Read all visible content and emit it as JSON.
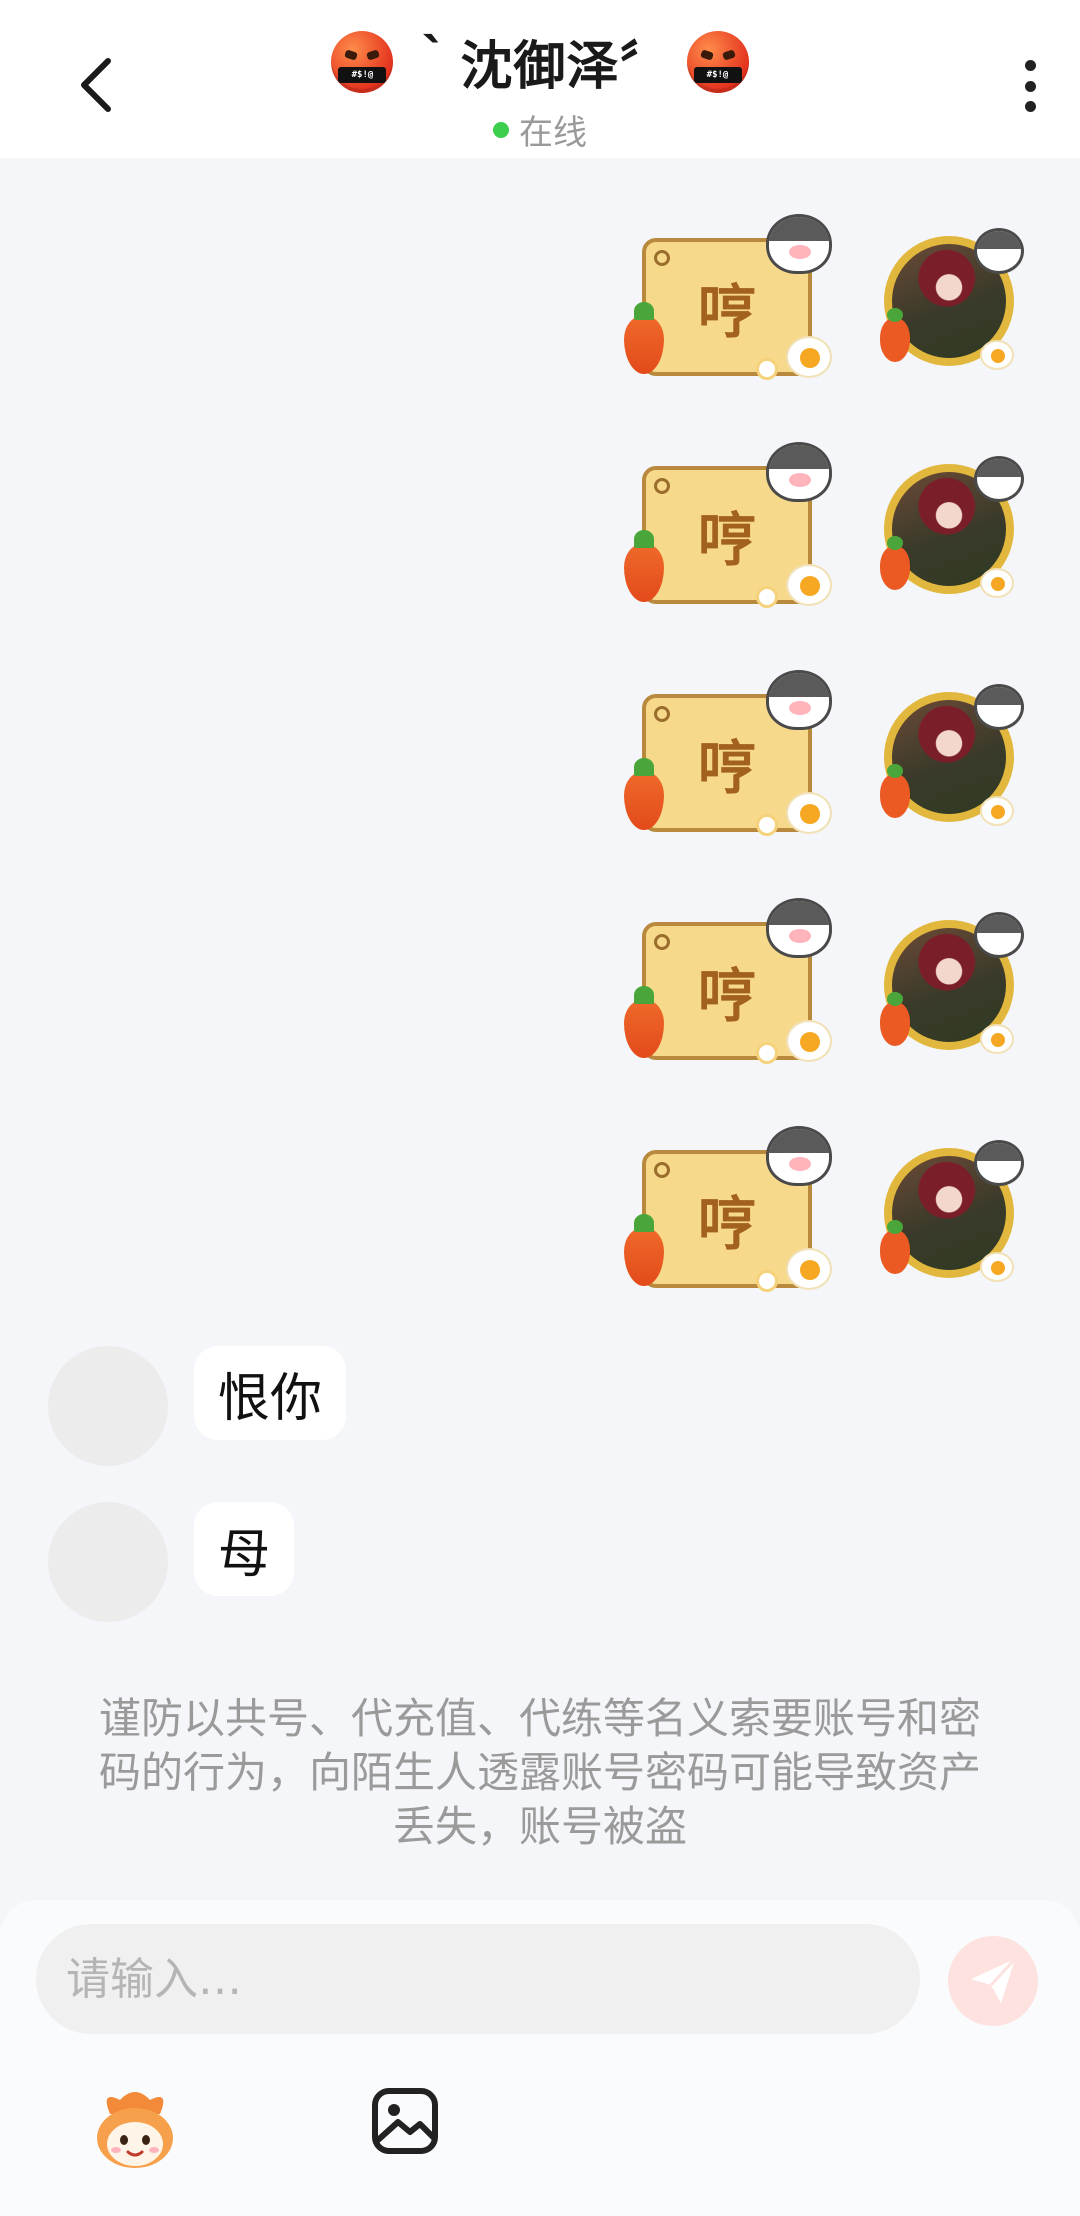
{
  "header": {
    "title": "｀沈御泽〞",
    "status_text": "在线",
    "emoji_symbol_text": "#$!@",
    "status_color": "#3ccf4e"
  },
  "messages": {
    "sent_stickers": [
      {
        "text": "哼"
      },
      {
        "text": "哼"
      },
      {
        "text": "哼"
      },
      {
        "text": "哼"
      },
      {
        "text": "哼"
      }
    ],
    "received": [
      {
        "text": "恨你"
      },
      {
        "text": "母"
      }
    ]
  },
  "notice": {
    "text": "谨防以共号、代充值、代练等名义索要账号和密码的行为，向陌生人透露账号密码可能导致资产丢失，账号被盗"
  },
  "input": {
    "placeholder": "请输入…",
    "value": ""
  },
  "icons": {
    "back": "chevron-left-icon",
    "more": "more-vertical-icon",
    "send": "send-icon",
    "emoji": "emoji-mascot-icon",
    "image": "image-icon"
  },
  "colors": {
    "background": "#f4f6f9",
    "send_button": "#fde2df"
  }
}
